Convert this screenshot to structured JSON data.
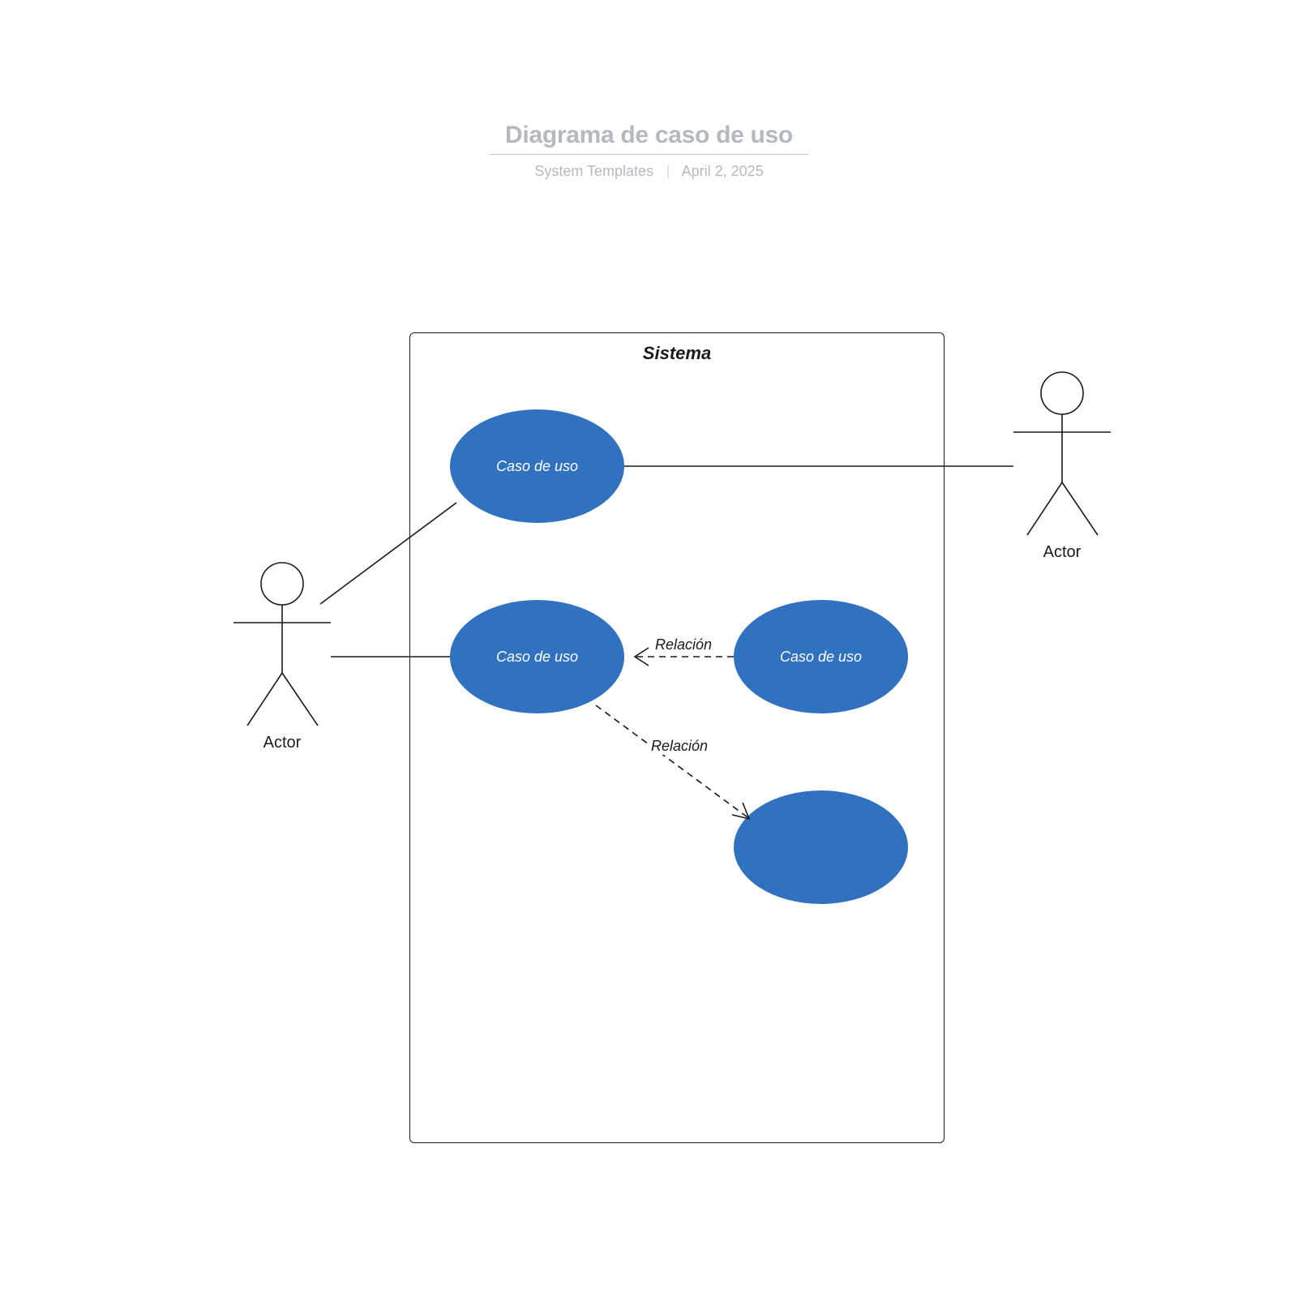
{
  "header": {
    "title": "Diagrama de caso de uso",
    "author": "System Templates",
    "date": "April 2, 2025"
  },
  "diagram": {
    "system_label": "Sistema",
    "actors": {
      "left": "Actor",
      "right": "Actor"
    },
    "usecases": {
      "uc1": "Caso de uso",
      "uc2": "Caso de uso",
      "uc3": "Caso de uso",
      "uc4": ""
    },
    "relations": {
      "r1": "Relación",
      "r2": "Relación"
    }
  }
}
